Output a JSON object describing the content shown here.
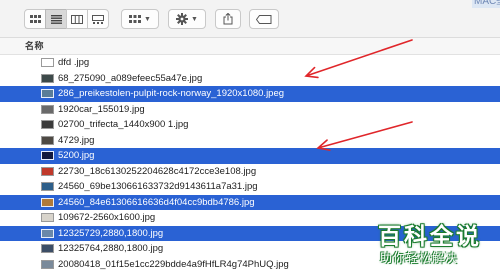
{
  "window": {
    "folder_title": "MAC壁纸"
  },
  "toolbar": {
    "view_icons": [
      "icon-view-icon",
      "list-view-icon",
      "column-view-icon",
      "gallery-view-icon"
    ],
    "active_view": 1
  },
  "columns": {
    "name_header": "名称"
  },
  "files": [
    {
      "name": "dfd .jpg",
      "selected": false,
      "thumb": "#ffffff"
    },
    {
      "name": "68_275090_a089efeec55a47e.jpg",
      "selected": false,
      "thumb": "#3d4a4a"
    },
    {
      "name": "286_preikestolen-pulpit-rock-norway_1920x1080.jpeg",
      "selected": true,
      "thumb": "#5a7d98"
    },
    {
      "name": "1920car_155019.jpg",
      "selected": false,
      "thumb": "#6a6a6a"
    },
    {
      "name": "02700_trifecta_1440x900 1.jpg",
      "selected": false,
      "thumb": "#3b3b3b"
    },
    {
      "name": "4729.jpg",
      "selected": false,
      "thumb": "#4e4a44"
    },
    {
      "name": "5200.jpg",
      "selected": true,
      "thumb": "#121a40"
    },
    {
      "name": "22730_18c6130252204628c4172cce3e108.jpg",
      "selected": false,
      "thumb": "#c0392b"
    },
    {
      "name": "24560_69be130661633732d9143611a7a31.jpg",
      "selected": false,
      "thumb": "#2e5f8a"
    },
    {
      "name": "24560_84e61306616636d4f04cc9bdb4786.jpg",
      "selected": true,
      "thumb": "#b07a3a"
    },
    {
      "name": "109672-2560x1600.jpg",
      "selected": false,
      "thumb": "#d8d4cc"
    },
    {
      "name": "12325729,2880,1800.jpg",
      "selected": true,
      "thumb": "#6a88aa"
    },
    {
      "name": "12325764,2880,1800.jpg",
      "selected": false,
      "thumb": "#3c4e66"
    },
    {
      "name": "20080418_01f15e1cc229bdde4a9fHfLR4g74PhUQ.jpg",
      "selected": false,
      "thumb": "#7a8a9a"
    }
  ],
  "annotations": {
    "arrow_color": "#e0262a"
  },
  "watermark": {
    "title": "百科全说",
    "subtitle": "助你轻松解决"
  }
}
